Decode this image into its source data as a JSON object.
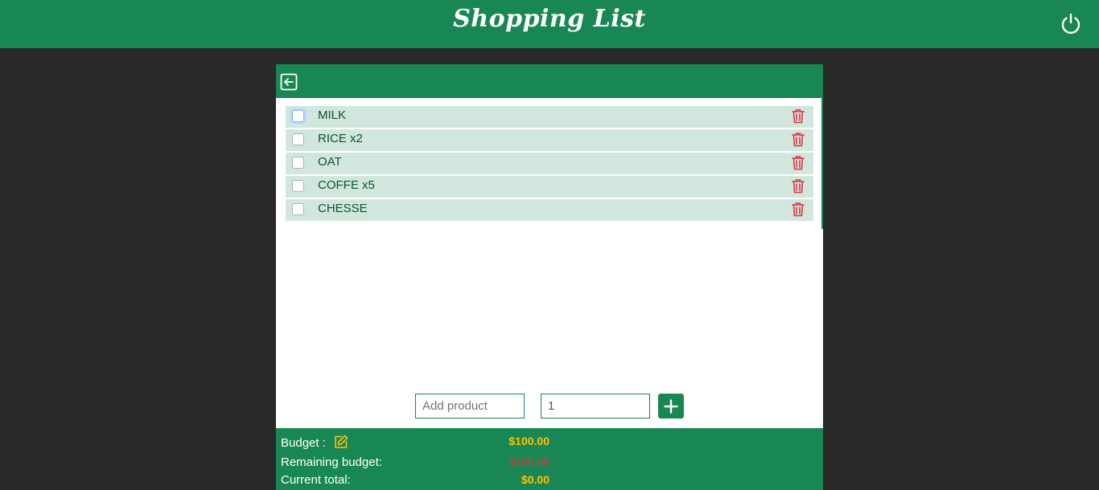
{
  "header": {
    "title": "Shopping List",
    "power_icon": "power-icon"
  },
  "panel": {
    "back_icon": "arrow-left-square-icon",
    "items": [
      {
        "name": "MILK",
        "checked": false
      },
      {
        "name": "RICE x2",
        "checked": false
      },
      {
        "name": "OAT",
        "checked": false
      },
      {
        "name": "COFFE x5",
        "checked": false
      },
      {
        "name": "CHESSE",
        "checked": false
      }
    ],
    "delete_icon": "trash-icon"
  },
  "add_form": {
    "product_placeholder": "Add product",
    "product_value": "",
    "quantity_value": "1",
    "add_icon": "plus-icon"
  },
  "summary": {
    "budget_label": "Budget :",
    "budget_value": "$100.00",
    "remaining_label": "Remaining budget:",
    "remaining_value": "$100.00",
    "total_label": "Current total:",
    "total_value": "$0.00",
    "edit_icon": "pencil-square-icon"
  },
  "colors": {
    "primary": "#198754",
    "item_bg": "#d1e7dd",
    "danger": "#dc3545",
    "warning": "#ffc107",
    "background": "#292929"
  }
}
